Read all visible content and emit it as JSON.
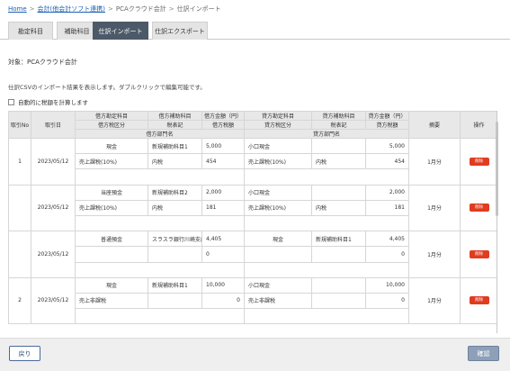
{
  "breadcrumb": {
    "home": "Home",
    "item1": "会計(他会計ソフト連携)",
    "item2": "PCAクラウド会計",
    "item3": "仕訳インポート"
  },
  "tabs": [
    {
      "label": "勘定科目",
      "active": false
    },
    {
      "label": "補助科目",
      "active": false
    },
    {
      "label": "仕訳インポート",
      "active": true
    },
    {
      "label": "仕訳エクスポート",
      "active": false
    }
  ],
  "subtitle": "対象：PCAクラウド会計",
  "description": "仕訳CSVのインポート結果を表示します。ダブルクリックで編集可能です。",
  "auto_tax_label": "自動的に税額を計算します",
  "table": {
    "headers": {
      "no": "取引No",
      "date": "取引日",
      "debit_account": "借方勘定科目",
      "debit_sub": "借方補助科目",
      "debit_amount": "借方金額（円）",
      "credit_account": "貸方勘定科目",
      "credit_sub": "貸方補助科目",
      "credit_amount": "貸方金額（円）",
      "summary": "摘要",
      "action": "操作",
      "debit_tax_class": "借方税区分",
      "debit_tax_note": "税表記",
      "debit_tax": "借方税額",
      "credit_tax_class": "貸方税区分",
      "credit_tax_note": "税表記",
      "credit_tax": "貸方税額",
      "debit_dept": "借方部門名",
      "credit_dept": "貸方部門名"
    },
    "rows": [
      {
        "no": "1",
        "date": "2023/05/12",
        "debit_account": "現金",
        "debit_sub": "新規補助科目1",
        "debit_amount": "5,000",
        "credit_account": "小口現金",
        "credit_sub": "",
        "credit_amount": "5,000",
        "debit_tax_class": "売上課税(10%)",
        "debit_tax_note": "内税",
        "debit_tax": "454",
        "credit_tax_class": "売上課税(10%)",
        "credit_tax_note": "内税",
        "credit_tax": "454",
        "summary": "1月分",
        "delete_label": "削除"
      },
      {
        "no": "",
        "date": "2023/05/12",
        "debit_account": "当座預金",
        "debit_sub": "新規補助科目2",
        "debit_amount": "2,000",
        "credit_account": "小口現金",
        "credit_sub": "",
        "credit_amount": "2,000",
        "debit_tax_class": "売上課税(10%)",
        "debit_tax_note": "内税",
        "debit_tax": "181",
        "credit_tax_class": "売上課税(10%)",
        "credit_tax_note": "内税",
        "credit_tax": "181",
        "summary": "1月分",
        "delete_label": "削除"
      },
      {
        "no": "",
        "date": "2023/05/12",
        "debit_account": "普通預金",
        "debit_sub": "スラスラ銀行川崎支店",
        "debit_amount": "4,405",
        "credit_account": "現金",
        "credit_sub": "新規補助科目1",
        "credit_amount": "4,405",
        "debit_tax_class": "",
        "debit_tax_note": "",
        "debit_tax": "0",
        "credit_tax_class": "",
        "credit_tax_note": "",
        "credit_tax": "0",
        "summary": "1月分",
        "delete_label": "削除"
      },
      {
        "no": "2",
        "date": "2023/05/12",
        "debit_account": "現金",
        "debit_sub": "新規補助科目1",
        "debit_amount": "10,000",
        "credit_account": "小口現金",
        "credit_sub": "",
        "credit_amount": "10,000",
        "debit_tax_class": "売上非課税",
        "debit_tax_note": "",
        "debit_tax": "0",
        "credit_tax_class": "売上非課税",
        "credit_tax_note": "",
        "credit_tax": "0",
        "summary": "1月分",
        "delete_label": "削除"
      }
    ]
  },
  "footer": {
    "back_label": "戻り",
    "confirm_label": "確認"
  },
  "colors": {
    "active_tab": "#4c5968",
    "delete_button": "#e03c1f",
    "confirm_button": "#8da0b8"
  }
}
